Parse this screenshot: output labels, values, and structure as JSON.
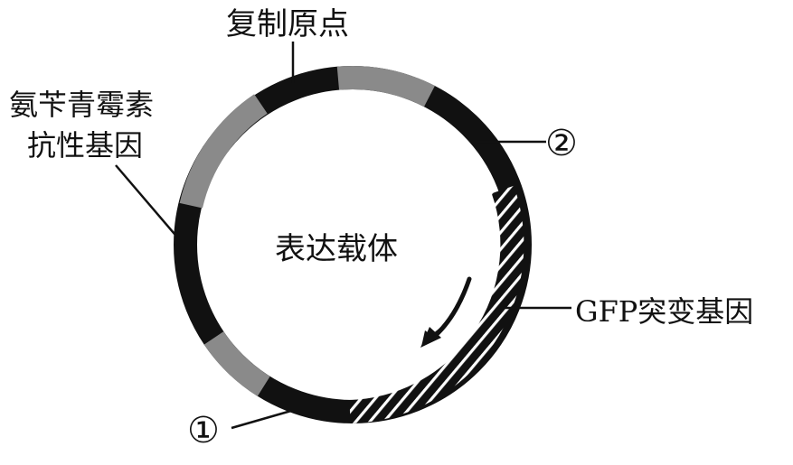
{
  "labels": {
    "origin": "复制原点",
    "amp_line1": "氨苄青霉素",
    "amp_line2": "抗性基因",
    "site1": "①",
    "site2": "②",
    "center": "表达载体",
    "gfp": "GFP突变基因"
  },
  "colors": {
    "ring_dark": "#111111",
    "ring_gray": "#8a8a8a",
    "hatch": "#ffffff",
    "text": "#111111"
  }
}
